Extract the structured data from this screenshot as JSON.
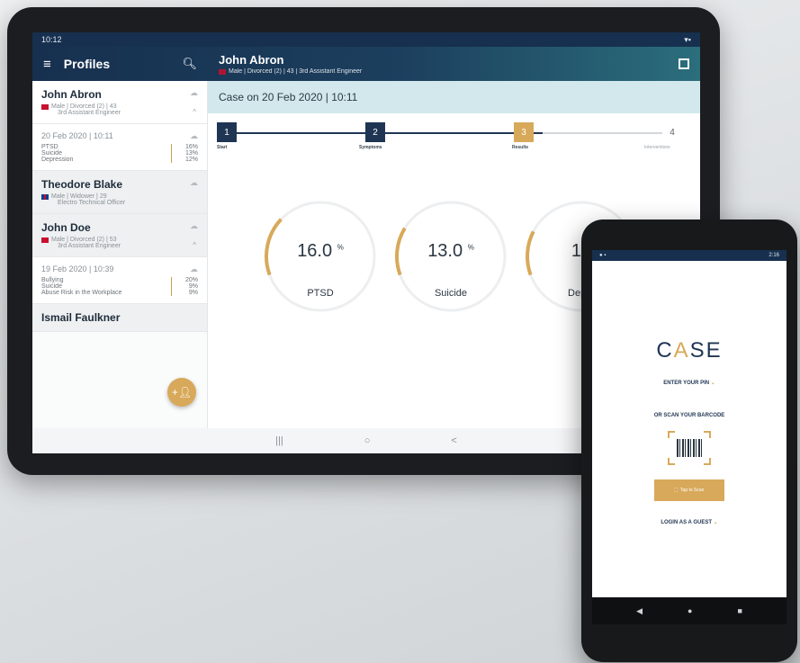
{
  "tablet": {
    "status": {
      "time": "10:12",
      "right": ""
    },
    "appbar": {
      "title": "Profiles",
      "patient_name": "John Abron",
      "patient_sub": "Male | Divorced (2) | 43 | 3rd Assistant Engineer"
    },
    "profiles": [
      {
        "name": "John Abron",
        "meta": "Male | Divorced (2) | 43",
        "role": "3rd Assistant Engineer"
      },
      {
        "name": "Theodore Blake",
        "meta": "Male | Widower | 29",
        "role": "Electro Technical Officer"
      },
      {
        "name": "John Doe",
        "meta": "Male | Divorced (2) | 53",
        "role": "3rd Assistant Engineer"
      },
      {
        "name": "Ismail Faulkner"
      }
    ],
    "cases": [
      {
        "date": "20 Feb 2020 | 10:11",
        "rows": [
          {
            "label": "PTSD",
            "value": "16%"
          },
          {
            "label": "Suicide",
            "value": "13%"
          },
          {
            "label": "Depression",
            "value": "12%"
          }
        ]
      },
      {
        "date": "19 Feb 2020 | 10:39",
        "rows": [
          {
            "label": "Bullying",
            "value": "20%"
          },
          {
            "label": "Suicide",
            "value": "9%"
          },
          {
            "label": "Abuse Risk in the Workplace",
            "value": "9%"
          }
        ]
      }
    ],
    "case_header": "Case on 20 Feb 2020 | 10:11",
    "steps": [
      {
        "num": "1",
        "label": "Start"
      },
      {
        "num": "2",
        "label": "Symptoms"
      },
      {
        "num": "3",
        "label": "Results"
      },
      {
        "num": "4",
        "label": "Interventions"
      }
    ],
    "gauges": [
      {
        "value": "16.0",
        "unit": "%",
        "label": "PTSD",
        "fraction": 0.16
      },
      {
        "value": "13.0",
        "unit": "%",
        "label": "Suicide",
        "fraction": 0.13
      },
      {
        "value": "12",
        "unit": "",
        "label": "Depre",
        "fraction": 0.12
      }
    ],
    "nav": {
      "recents": "|||",
      "home": "○",
      "back": "<"
    }
  },
  "phone": {
    "status": {
      "left": "",
      "right": "2:16"
    },
    "logo": {
      "part1": "C",
      "part2": "A",
      "part3": "SE"
    },
    "enter_pin": "ENTER YOUR PIN",
    "scan_barcode": "OR SCAN YOUR BARCODE",
    "scan_button": "Tap to Scan",
    "guest": "LOGIN AS A GUEST",
    "nav": {
      "back": "◀",
      "home": "●",
      "recents": "■"
    }
  },
  "colors": {
    "accent": "#d8a95a",
    "navy": "#1f3553",
    "teal_header": "#d2e8ec"
  }
}
